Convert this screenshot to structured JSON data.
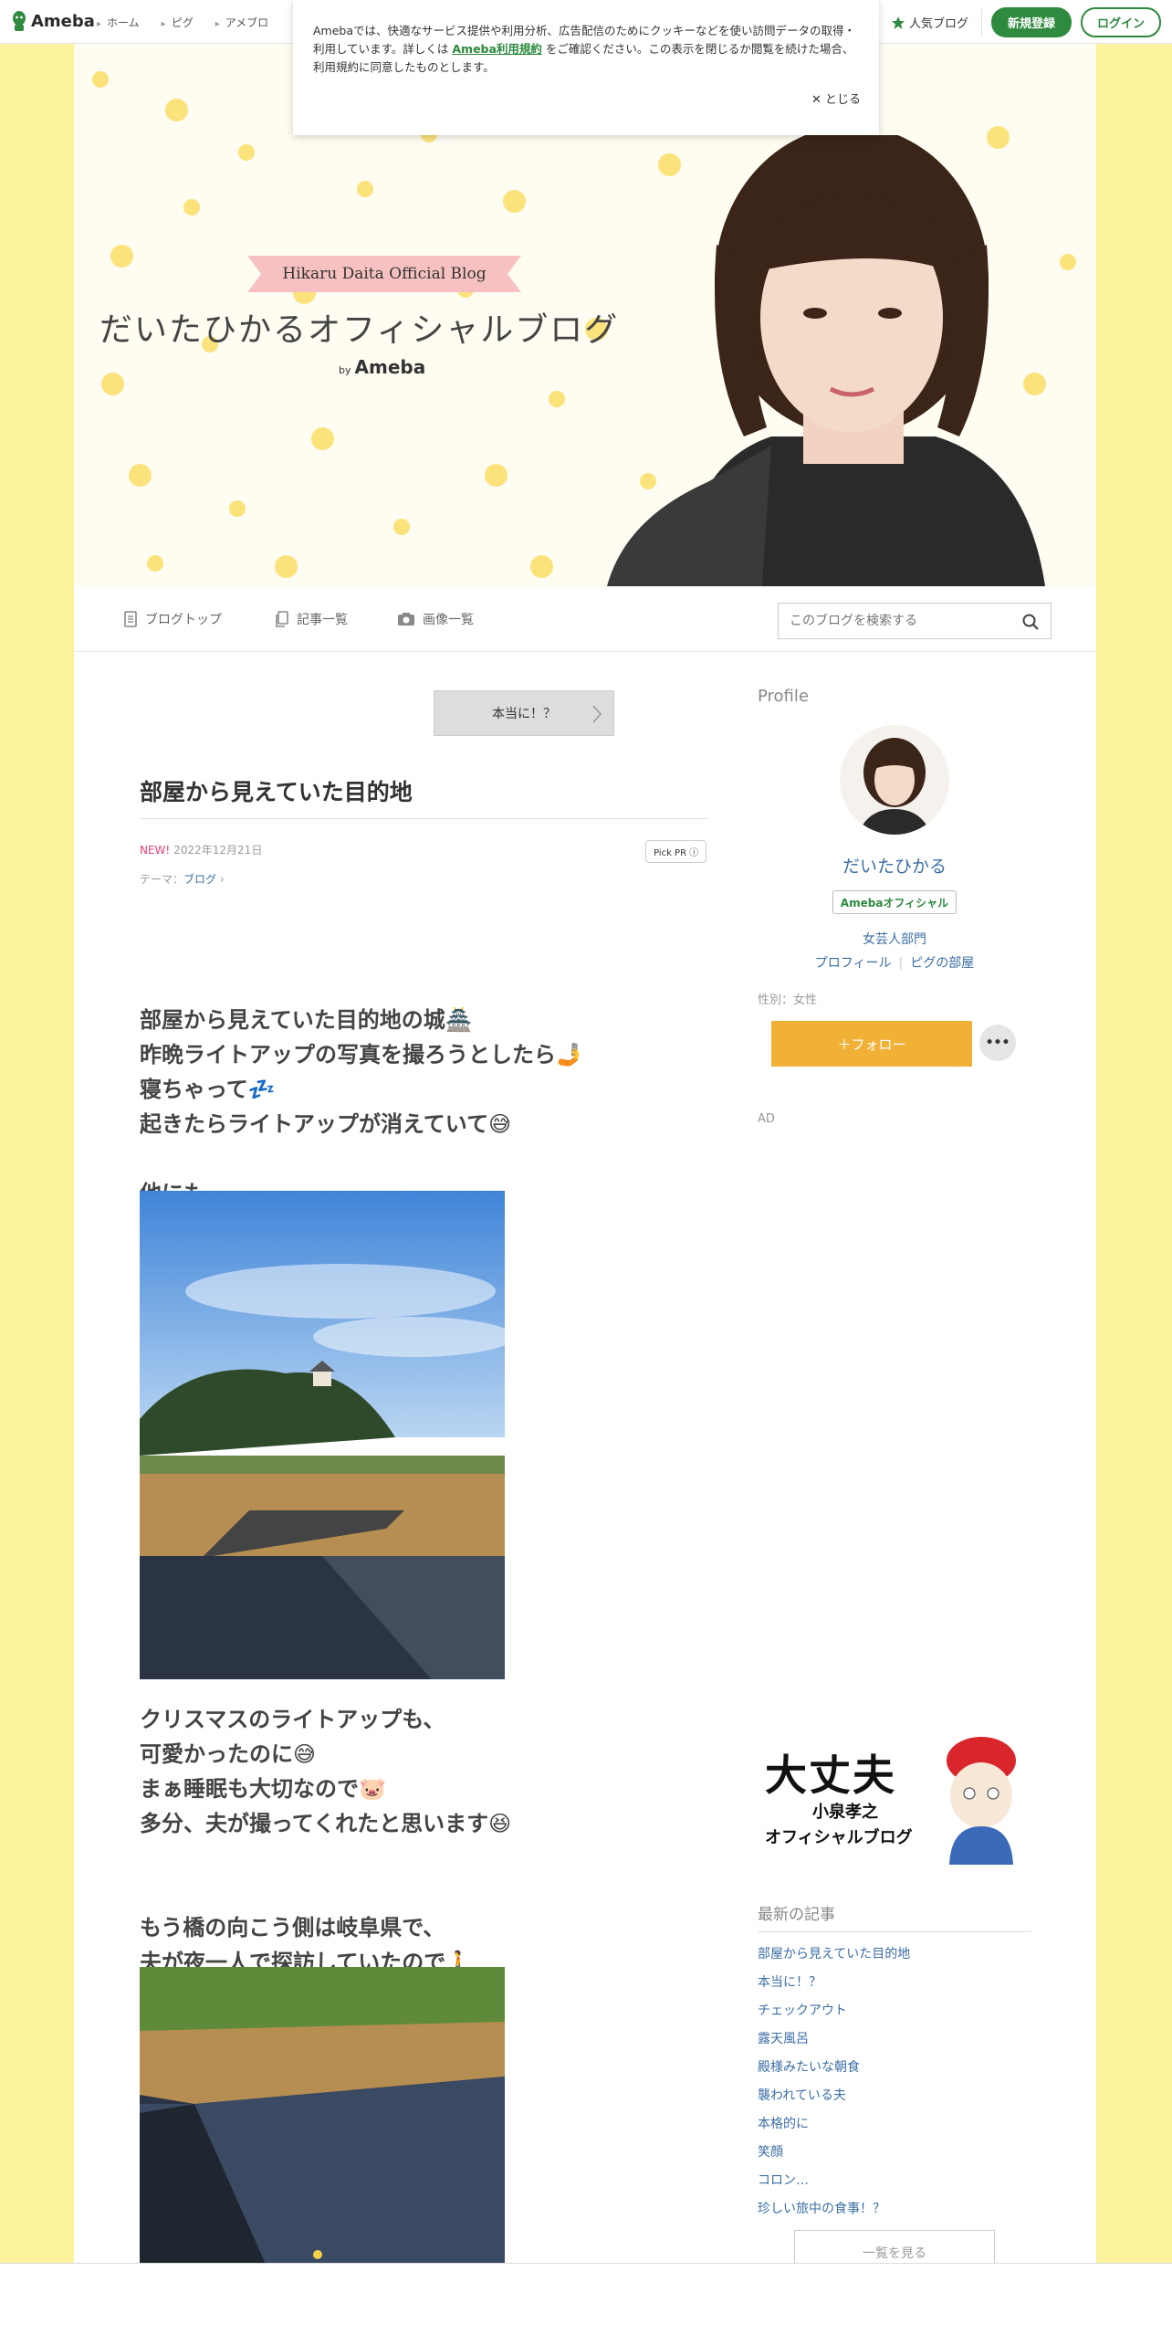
{
  "topbar": {
    "logo": "Ameba",
    "nav": [
      "ホーム",
      "ピグ",
      "アメブロ"
    ],
    "popular_blog": "人気ブログ",
    "signup": "新規登録",
    "login": "ログイン"
  },
  "cookie": {
    "text_before": "Amebaでは、快適なサービス提供や利用分析、広告配信のためにクッキーなどを使い訪問データの取得・利用しています。詳しくは",
    "link": "Ameba利用規約",
    "text_after": "をご確認ください。この表示を閉じるか閲覧を続けた場合、利用規約に同意したものとします。",
    "close": "✕ とじる"
  },
  "header": {
    "banner": "Hikaru Daita Official Blog",
    "title": "だいたひかるオフィシャルブログ",
    "by": "by",
    "brand": "Ameba"
  },
  "blognav": {
    "top": "ブログトップ",
    "entries": "記事一覧",
    "images": "画像一覧",
    "search_placeholder": "このブログを検索する"
  },
  "article": {
    "prev": "本当に！？",
    "title": "部屋から見えていた目的地",
    "new": "NEW!",
    "date": "2022年12月21日",
    "theme_label": "テーマ：",
    "theme": "ブログ",
    "pickpr": "Pick PR ⓘ",
    "p1": [
      "部屋から見えていた目的地の城🏯",
      "昨晩ライトアップの写真を撮ろうとしたら🤳",
      "寝ちゃって💤",
      "起きたらライトアップが消えていて😅"
    ],
    "p2": "他にも…",
    "p3": [
      "クリスマスのライトアップも、",
      "可愛かったのに😅",
      "まぁ睡眠も大切なので🐷",
      "多分、夫が撮ってくれたと思います😆"
    ],
    "p4": [
      "もう橋の向こう側は岐阜県で、",
      "夫が夜一人で探訪していたので🚶"
    ]
  },
  "sidebar": {
    "profile_heading": "Profile",
    "name": "だいたひかる",
    "official": "Amebaオフィシャル",
    "genre": "女芸人部門",
    "profile_link": "プロフィール",
    "pig_link": "ピグの部屋",
    "gender": "性別：女性",
    "follow": "＋フォロー",
    "more": "•••",
    "ad": "AD",
    "ad_title": "大丈夫",
    "ad_sub1": "小泉孝之",
    "ad_sub2": "オフィシャルブログ",
    "recent_heading": "最新の記事",
    "recent": [
      "部屋から見えていた目的地",
      "本当に！？",
      "チェックアウト",
      "露天風呂",
      "殿様みたいな朝食",
      "襲われている夫",
      "本格的に",
      "笑顔",
      "コロン…",
      "珍しい旅中の食事！？"
    ],
    "see_all": "一覧を見る"
  },
  "colors": {
    "page_bg": "#fdf29e",
    "accent_green": "#2d8a3e",
    "link_blue": "#3b6ea5",
    "follow_orange": "#f0b136"
  }
}
